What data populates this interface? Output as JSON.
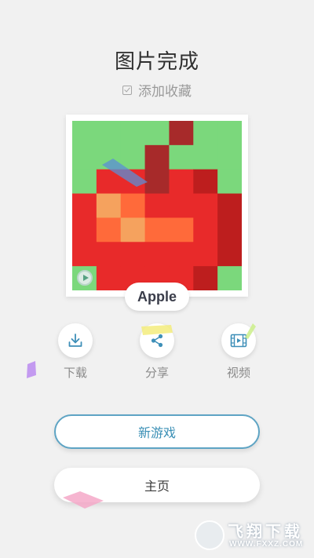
{
  "header": {
    "title": "图片完成",
    "favorite_label": "添加收藏"
  },
  "artwork": {
    "name": "Apple",
    "grid_size": 7,
    "colors": {
      "G": "#7bd87c",
      "D": "#a72a2a",
      "R": "#e82a2a",
      "K": "#bd1e1e",
      "O": "#ff6a3a",
      "Y": "#f5a25e"
    },
    "pixels": [
      "GGGGDGG",
      "GGGDGGG",
      "GRRDRKG",
      "RYORRRK",
      "ROYOORK",
      "RRRRRRK",
      "GRRRRKG"
    ]
  },
  "actions": [
    {
      "id": "download",
      "label": "下载",
      "icon": "download-icon"
    },
    {
      "id": "share",
      "label": "分享",
      "icon": "share-icon"
    },
    {
      "id": "video",
      "label": "视频",
      "icon": "video-icon"
    }
  ],
  "buttons": {
    "new_game": "新游戏",
    "home": "主页"
  },
  "watermark": {
    "text": "飞翔下载",
    "url": "WWW.FXXZ.COM"
  },
  "theme": {
    "background": "#f1f1f1",
    "accent": "#3a8fb5"
  }
}
